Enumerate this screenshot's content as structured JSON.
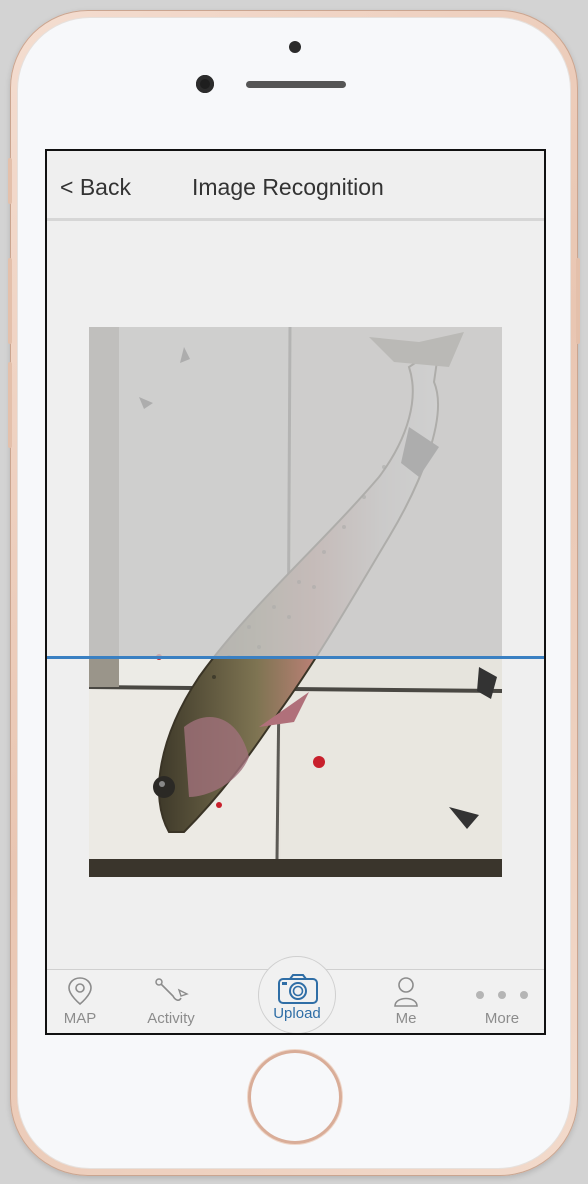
{
  "nav": {
    "back_label": "< Back",
    "title": "Image Recognition"
  },
  "scan": {
    "progress": 0.6
  },
  "tabbar": {
    "items": [
      {
        "label": "MAP",
        "icon": "map-pin-icon"
      },
      {
        "label": "Activity",
        "icon": "fishing-hook-icon"
      },
      {
        "label": "Upload",
        "icon": "camera-icon",
        "active": true
      },
      {
        "label": "Me",
        "icon": "person-icon"
      },
      {
        "label": "More",
        "icon": "more-dots-icon"
      }
    ],
    "active_color": "#2f6ea6",
    "inactive_color": "#8c8c8c"
  },
  "colors": {
    "scan_line": "#3a80c2",
    "overlay": "#c8c8c8"
  }
}
